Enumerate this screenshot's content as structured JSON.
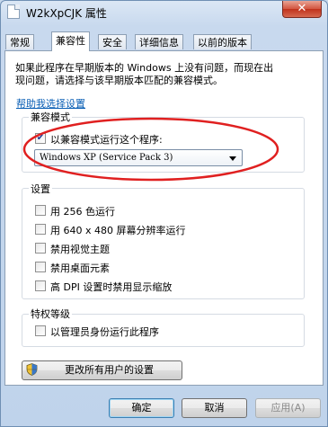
{
  "window": {
    "title": "W2kXpCJK 属性",
    "close_label": "✕"
  },
  "tabs": [
    {
      "label": "常规"
    },
    {
      "label": "兼容性"
    },
    {
      "label": "安全"
    },
    {
      "label": "详细信息"
    },
    {
      "label": "以前的版本"
    }
  ],
  "intro": {
    "line1": "如果此程序在早期版本的 Windows 上没有问题，而现在出",
    "line2": "现问题，请选择与该早期版本匹配的兼容模式。"
  },
  "help_link": "帮助我选择设置",
  "compat_mode": {
    "group_label": "兼容模式",
    "checkbox_label": "以兼容模式运行这个程序:",
    "checked": true,
    "selected_os": "Windows XP (Service Pack 3)"
  },
  "settings": {
    "group_label": "设置",
    "options": [
      {
        "label": "用 256 色运行",
        "checked": false
      },
      {
        "label": "用 640 x 480 屏幕分辨率运行",
        "checked": false
      },
      {
        "label": "禁用视觉主题",
        "checked": false
      },
      {
        "label": "禁用桌面元素",
        "checked": false
      },
      {
        "label": "高 DPI 设置时禁用显示缩放",
        "checked": false
      }
    ]
  },
  "privilege": {
    "group_label": "特权等级",
    "checkbox_label": "以管理员身份运行此程序",
    "checked": false
  },
  "change_all_users_button": "更改所有用户的设置",
  "buttons": {
    "ok": "确定",
    "cancel": "取消",
    "apply": "应用(A)"
  },
  "colors": {
    "highlight_ellipse": "#e02020",
    "link": "#0a5fb5"
  }
}
